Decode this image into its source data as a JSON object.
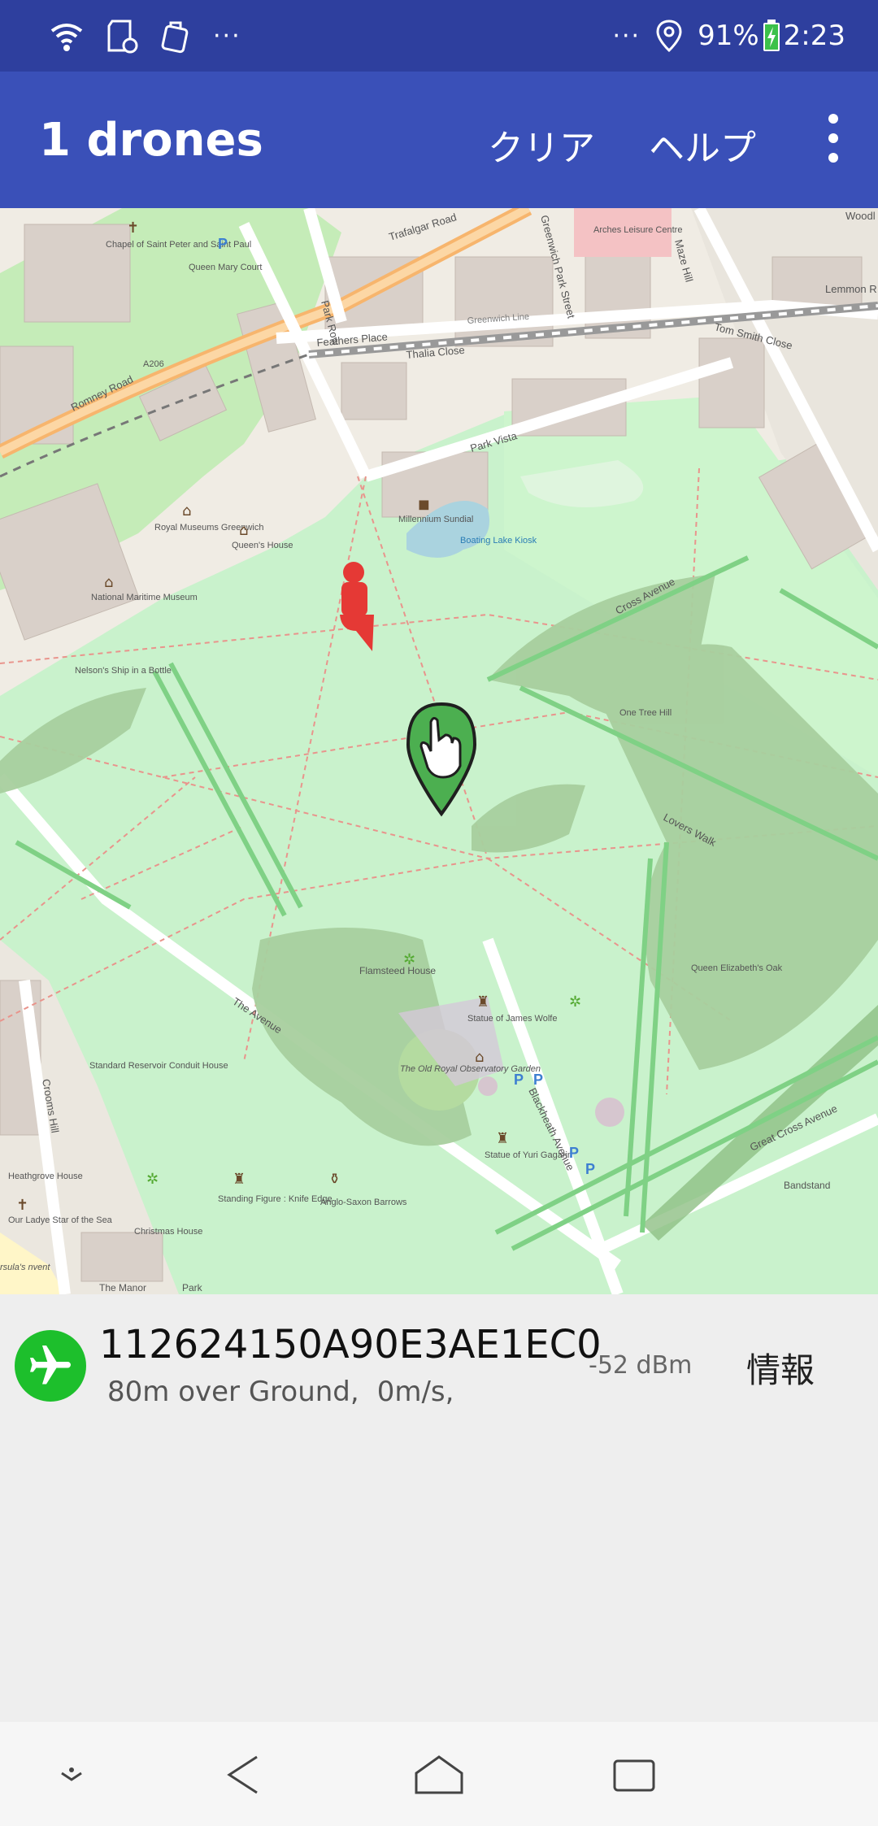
{
  "status_bar": {
    "icons_left": [
      "wifi-icon",
      "sd-card-icon",
      "shop-bag-icon"
    ],
    "more_left": "···",
    "more_right": "···",
    "battery_percent": "91%",
    "time": "2:23"
  },
  "app_bar": {
    "title": "1 drones",
    "clear_label": "クリア",
    "help_label": "ヘルプ",
    "overflow_icon": "more-vert-icon"
  },
  "map": {
    "labels": {
      "trafalgar_road": "Trafalgar Road",
      "romney_road": "Romney Road",
      "a206": "A206",
      "park_row": "Park Row",
      "feathers_place": "Feathers Place",
      "thalia_close": "Thalia Close",
      "park_vista": "Park Vista",
      "greenwich_park_street": "Greenwich Park Street",
      "maze_hill": "Maze Hill",
      "tom_smith_close": "Tom Smith Close",
      "lemmon_road": "Lemmon R",
      "royal_museums": "Royal Museums Greenwich",
      "queens_house": "Queen's House",
      "national_maritime_museum": "National Maritime Museum",
      "millennium_sundial": "Millennium Sundial",
      "boating_lake_kiosk": "Boating Lake Kiosk",
      "cross_avenue": "Cross Avenue",
      "one_tree_hill": "One Tree Hill",
      "lovers_walk": "Lovers Walk",
      "queen_elizabeths_oak": "Queen Elizabeth's Oak",
      "flamsteed_house": "Flamsteed House",
      "statue_james_wolfe": "Statue of James Wolfe",
      "royal_observatory_garden": "The Old Royal Observatory Garden",
      "blackheath_avenue": "Blackheath Avenue",
      "great_cross_avenue": "Great Cross Avenue",
      "bandstand": "Bandstand",
      "the_avenue": "The Avenue",
      "standard_reservoir": "Standard Reservoir Conduit House",
      "crooms_hill": "Crooms Hill",
      "heathgrove_house": "Heathgrove House",
      "our_ladye_star": "Our Ladye Star of the Sea",
      "christmas_house": "Christmas House",
      "standing_figure": "Standing Figure : Knife Edge",
      "anglo_saxon_barrows": "Anglo-Saxon Barrows",
      "statue_yuri_gagarin": "Statue of Yuri Gagarin",
      "the_manor": "The Manor",
      "park": "Park",
      "chapel": "Chapel of Saint Peter and Saint Paul",
      "queen_mary_court": "Queen Mary Court",
      "nelsons_ship": "Nelson's Ship in a Bottle",
      "arches_leisure": "Arches Leisure Centre",
      "greenwich_line": "Greenwich Line",
      "woodl": "Woodl",
      "ursulas_convent": "rsula's nvent"
    },
    "marker_color_drone": "#e53935",
    "marker_color_pilot": "#43a047"
  },
  "drone": {
    "icon": "airplane-icon",
    "id": "112624150A90E3AE1EC0",
    "altitude": "80m over Ground,",
    "speed": "0m/s,",
    "signal": "-52 dBm",
    "info_label": "情報"
  },
  "nav_bar": {
    "buttons": [
      "notifications-down-icon",
      "back-icon",
      "home-icon",
      "recents-icon"
    ]
  }
}
